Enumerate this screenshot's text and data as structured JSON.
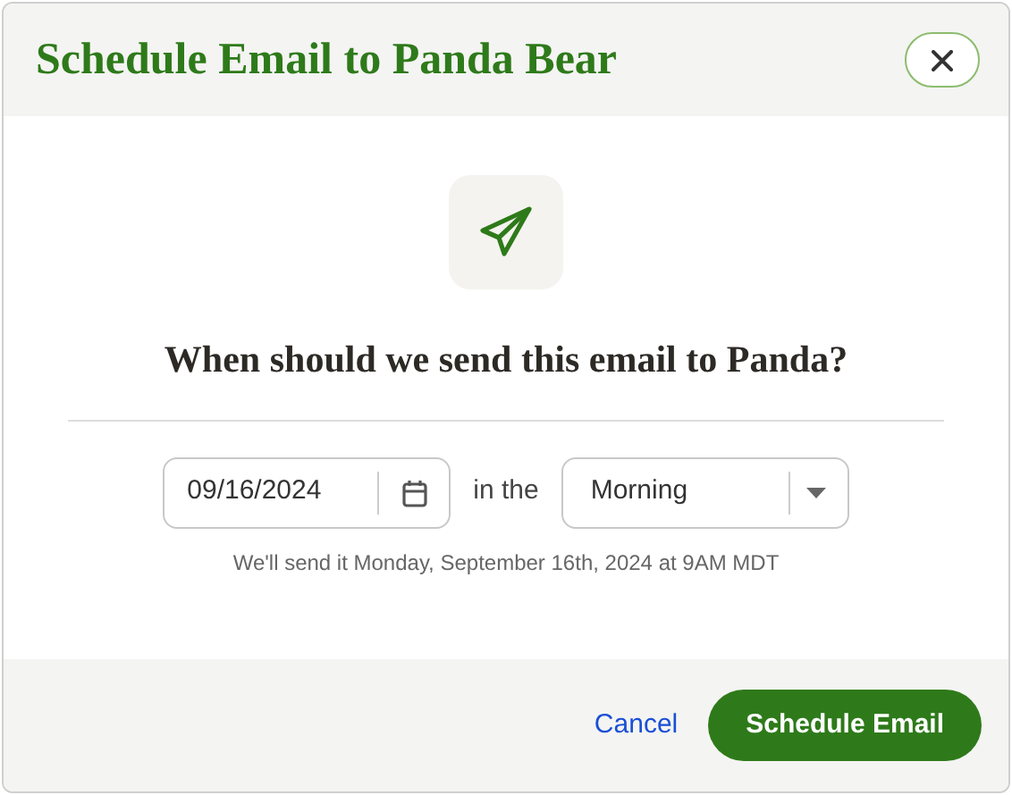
{
  "dialog": {
    "title": "Schedule Email to Panda Bear",
    "question": "When should we send this email to Panda?",
    "date_field": {
      "value": "09/16/2024"
    },
    "connector": "in the",
    "time_select": {
      "value": "Morning"
    },
    "summary": "We'll send it Monday, September 16th, 2024 at 9AM MDT",
    "buttons": [
      {
        "label": "Cancel",
        "kind": "link"
      },
      {
        "label": "Schedule Email",
        "kind": "primary"
      }
    ]
  }
}
